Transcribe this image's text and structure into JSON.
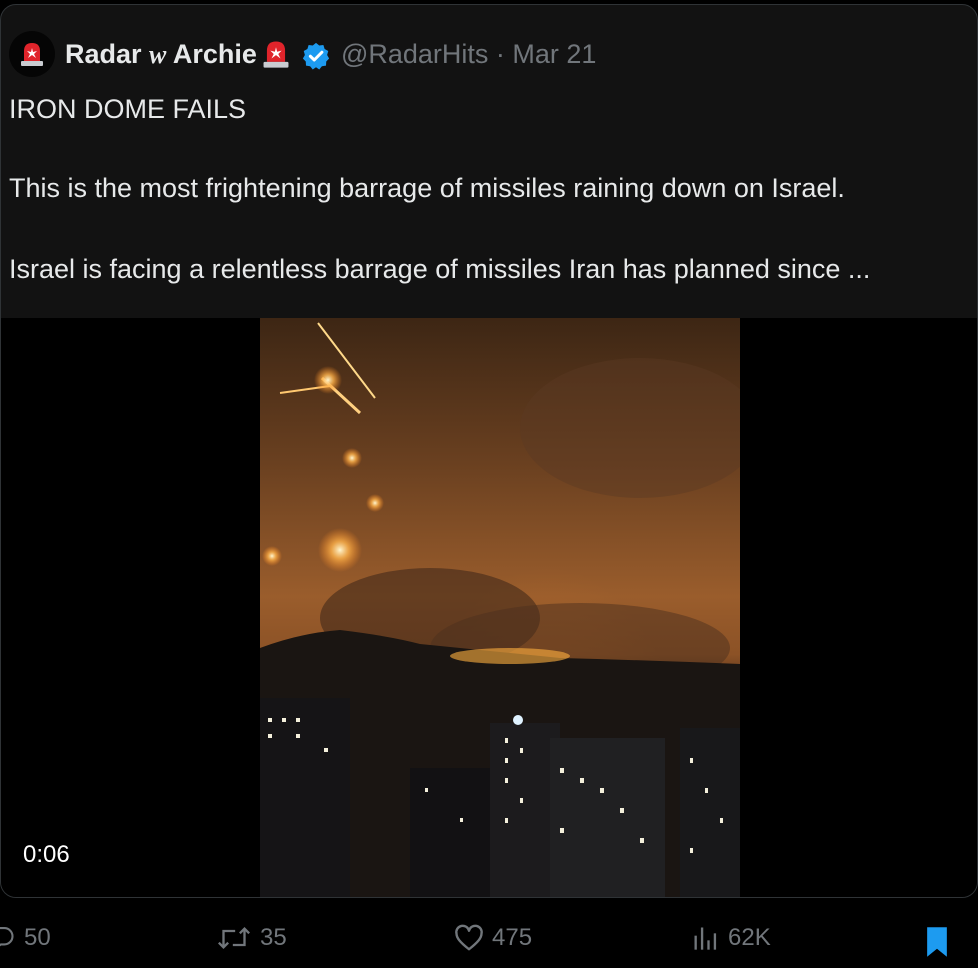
{
  "post": {
    "author_name": "Radar",
    "author_name_w": "w",
    "author_name_end": "Archie",
    "author_emoji_icon": "siren-icon",
    "verified_icon": "verified-badge-icon",
    "handle_date": "@RadarHits · Mar 21",
    "lines": [
      "IRON DOME FAILS",
      "This is the most frightening barrage of missiles raining down on Israel.",
      "Israel is facing a relentless barrage of missiles Iran has planned since ..."
    ]
  },
  "video": {
    "duration": "0:06"
  },
  "actions": {
    "replies": "50",
    "reposts": "35",
    "likes": "475",
    "views": "62K"
  },
  "colors": {
    "background": "#000000",
    "card": "#121212",
    "text": "#e7e9ea",
    "muted": "#71767b",
    "accent": "#1d9bf0"
  }
}
